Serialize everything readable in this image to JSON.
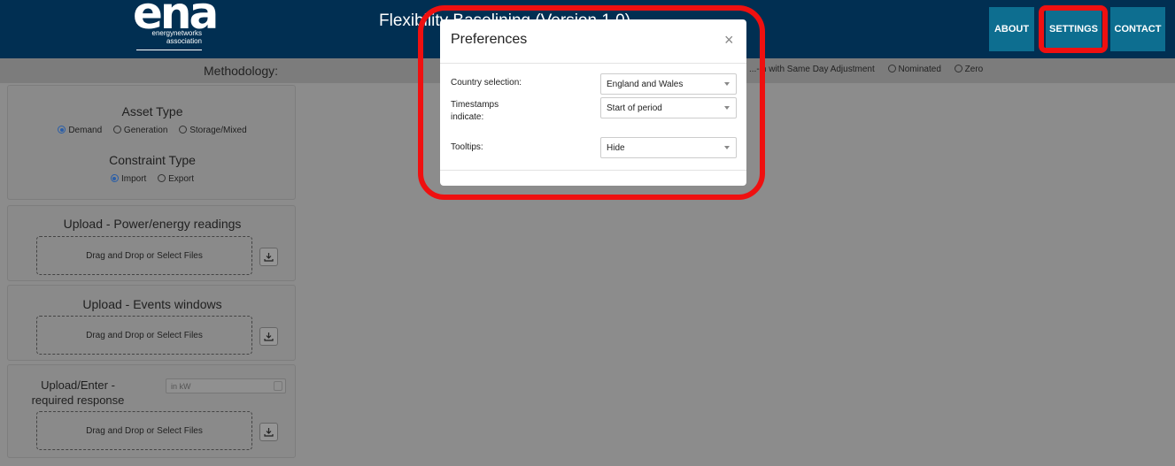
{
  "header": {
    "logo_text": "ena",
    "logo_line1": "energynetworks",
    "logo_line2": "association",
    "app_title": "Flexibility Baselining (Version 1.0)",
    "nav": [
      "ABOUT",
      "SETTINGS",
      "CONTACT"
    ]
  },
  "methodology": {
    "label": "Methodology:",
    "options_visible": [
      "...-in with Same Day Adjustment",
      "Nominated",
      "Zero"
    ]
  },
  "asset_panel": {
    "asset_title": "Asset Type",
    "asset_options": [
      "Demand",
      "Generation",
      "Storage/Mixed"
    ],
    "asset_selected": "Demand",
    "constraint_title": "Constraint Type",
    "constraint_options": [
      "Import",
      "Export"
    ],
    "constraint_selected": "Import"
  },
  "uploads": [
    {
      "title": "Upload - Power/energy readings",
      "dropzone": "Drag and Drop or Select Files"
    },
    {
      "title": "Upload - Events windows",
      "dropzone": "Drag and Drop or Select Files"
    },
    {
      "title": "Upload/Enter - required response",
      "dropzone": "Drag and Drop or Select Files",
      "input_placeholder": "in kW"
    }
  ],
  "modal": {
    "title": "Preferences",
    "close": "×",
    "rows": [
      {
        "label": "Country selection:",
        "value": "England and Wales"
      },
      {
        "label": "Timestamps indicate:",
        "value": "Start of period"
      },
      {
        "label": "Tooltips:",
        "value": "Hide"
      }
    ]
  },
  "colors": {
    "header_bg": "#012f52",
    "nav_button": "#0d6e90",
    "highlight": "#ef1010",
    "radio_selected": "#2a5ea8"
  }
}
